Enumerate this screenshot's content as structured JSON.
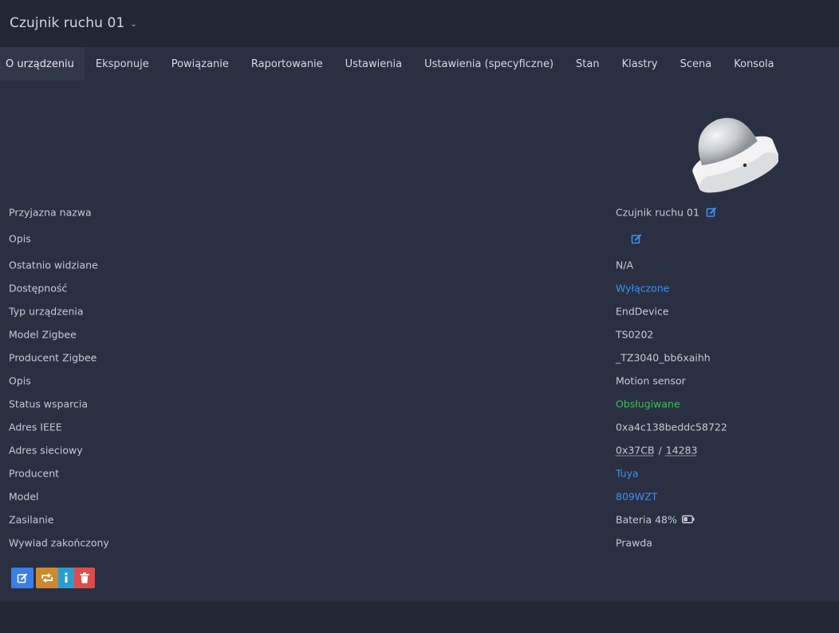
{
  "header": {
    "device_title": "Czujnik ruchu 01",
    "dropdown_icon": "chevron-down-icon"
  },
  "tabs": [
    {
      "label": "O urządzeniu",
      "active": true
    },
    {
      "label": "Eksponuje"
    },
    {
      "label": "Powiązanie"
    },
    {
      "label": "Raportowanie"
    },
    {
      "label": "Ustawienia"
    },
    {
      "label": "Ustawienia (specyficzne)"
    },
    {
      "label": "Stan"
    },
    {
      "label": "Klastry"
    },
    {
      "label": "Scena"
    },
    {
      "label": "Konsola"
    }
  ],
  "device_image": {
    "icon": "motion-sensor-image"
  },
  "details": {
    "friendly_name": {
      "label": "Przyjazna nazwa",
      "value": "Czujnik ruchu 01"
    },
    "description": {
      "label": "Opis",
      "value": ""
    },
    "last_seen": {
      "label": "Ostatnio widziane",
      "value": "N/A"
    },
    "availability": {
      "label": "Dostępność",
      "value": "Wyłączone"
    },
    "device_type": {
      "label": "Typ urządzenia",
      "value": "EndDevice"
    },
    "zigbee_model": {
      "label": "Model Zigbee",
      "value": "TS0202"
    },
    "zigbee_manufacturer": {
      "label": "Producent Zigbee",
      "value": "_TZ3040_bb6xaihh"
    },
    "model_description": {
      "label": "Opis",
      "value": "Motion sensor"
    },
    "support_status": {
      "label": "Status wsparcia",
      "value": "Obsługiwane"
    },
    "ieee_address": {
      "label": "Adres IEEE",
      "value": "0xa4c138beddc58722"
    },
    "network_address": {
      "label": "Adres sieciowy",
      "hex": "0x37CB",
      "separator": "/",
      "dec": "14283"
    },
    "vendor": {
      "label": "Producent",
      "value": "Tuya"
    },
    "model": {
      "label": "Model",
      "value": "809WZT"
    },
    "power": {
      "label": "Zasilanie",
      "value": "Bateria 48%",
      "battery_level_percent": 48
    },
    "interview_completed": {
      "label": "Wywiad zakończony",
      "value": "Prawda"
    }
  },
  "colors": {
    "link": "#3f8ff5",
    "supported": "#3ebd5d",
    "edit_button": "#3a7ee8",
    "reconfigure_button": "#cc8a2c",
    "info_button": "#2b9ccd",
    "remove_button": "#dc4c4c"
  },
  "actions": [
    {
      "icon": "edit-icon"
    },
    {
      "icon": "reconfigure-icon"
    },
    {
      "icon": "info-icon"
    },
    {
      "icon": "trash-icon"
    }
  ]
}
